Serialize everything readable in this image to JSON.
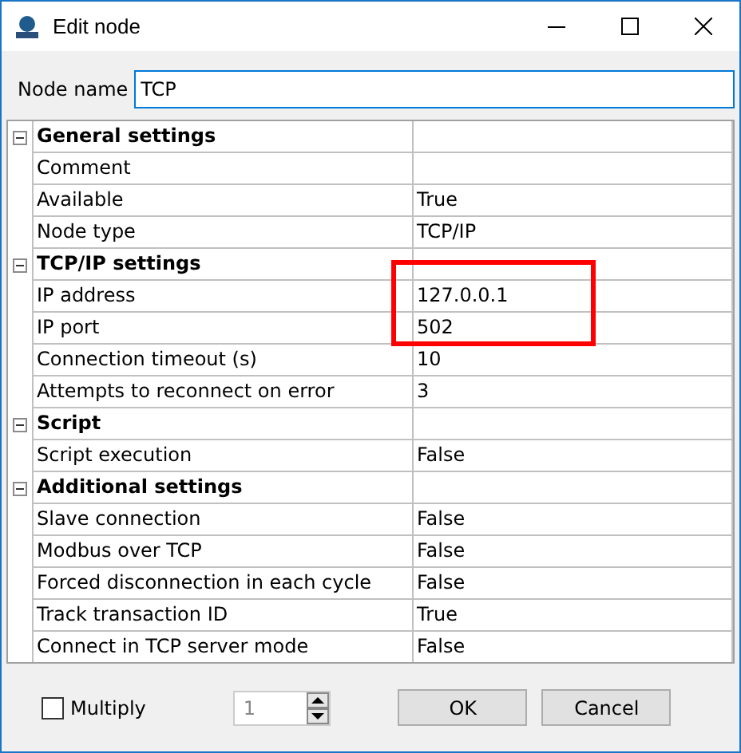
{
  "window": {
    "title": "Edit node"
  },
  "node_name": {
    "label": "Node name",
    "value": "TCP"
  },
  "groups": [
    {
      "title": "General settings",
      "expanded": true,
      "properties": [
        {
          "name": "Comment"
        },
        {
          "name": "Available",
          "value": "True"
        },
        {
          "name": "Node type",
          "value": "TCP/IP"
        }
      ]
    },
    {
      "title": "TCP/IP settings",
      "expanded": true,
      "properties": [
        {
          "name": "IP address",
          "value": "127.0.0.1",
          "highlighted": true
        },
        {
          "name": "IP port",
          "value": "502",
          "highlighted": true
        },
        {
          "name": "Connection timeout (s)",
          "value": "10"
        },
        {
          "name": "Attempts to reconnect on error",
          "value": "3"
        }
      ]
    },
    {
      "title": "Script",
      "expanded": true,
      "properties": [
        {
          "name": "Script execution",
          "value": "False"
        }
      ]
    },
    {
      "title": "Additional settings",
      "expanded": true,
      "properties": [
        {
          "name": "Slave connection",
          "value": "False"
        },
        {
          "name": "Modbus over TCP",
          "value": "False"
        },
        {
          "name": "Forced disconnection in each cycle",
          "value": "False"
        },
        {
          "name": "Track transaction ID",
          "value": "True"
        },
        {
          "name": "Connect in TCP server mode",
          "value": "False"
        }
      ]
    }
  ],
  "multiply": {
    "label": "Multiply",
    "checked": false,
    "count": "1",
    "disabled": true
  },
  "buttons": [
    "OK",
    "Cancel"
  ]
}
